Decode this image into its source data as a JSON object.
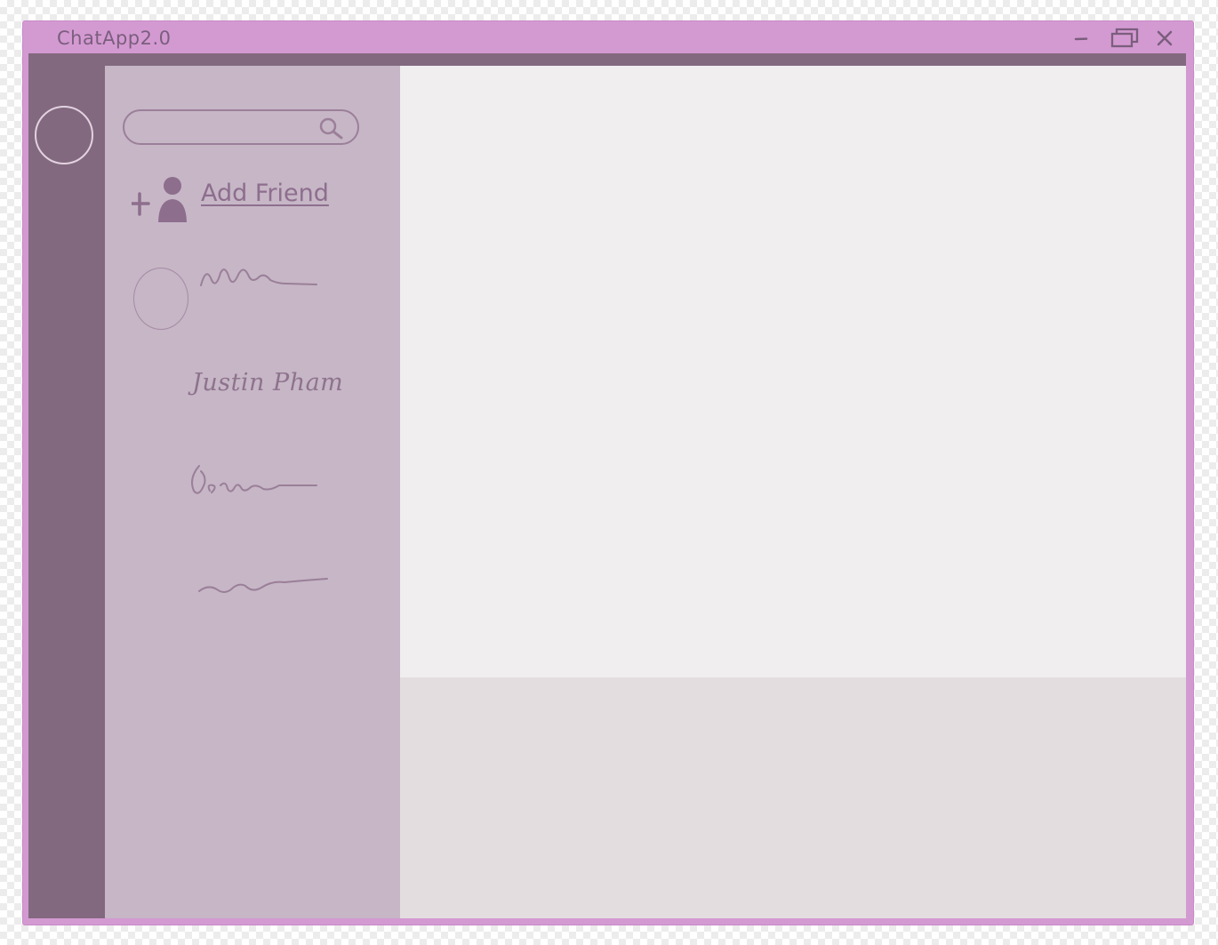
{
  "window": {
    "title": "ChatApp2.0",
    "controls": {
      "minimize_icon": "minimize-icon",
      "maximize_icon": "restore-window-icon",
      "close_icon": "close-icon"
    }
  },
  "colors": {
    "title_bar": "#d39ad2",
    "rail": "#83697f",
    "friends_panel": "#c6b6c6",
    "chat_area": "#f0eeef",
    "compose_area": "#e3dde0",
    "ink": "#8d6e8d"
  },
  "sidebar": {
    "profile_avatar": "profile-avatar"
  },
  "friends": {
    "search": {
      "placeholder": "",
      "icon": "search-icon"
    },
    "add_friend": {
      "label": "Add Friend",
      "icon": "add-friend-icon"
    },
    "contacts": [
      {
        "name": "",
        "avatar": "contact-avatar"
      },
      {
        "name": "Justin Pham"
      },
      {
        "name": ""
      },
      {
        "name": ""
      }
    ]
  }
}
